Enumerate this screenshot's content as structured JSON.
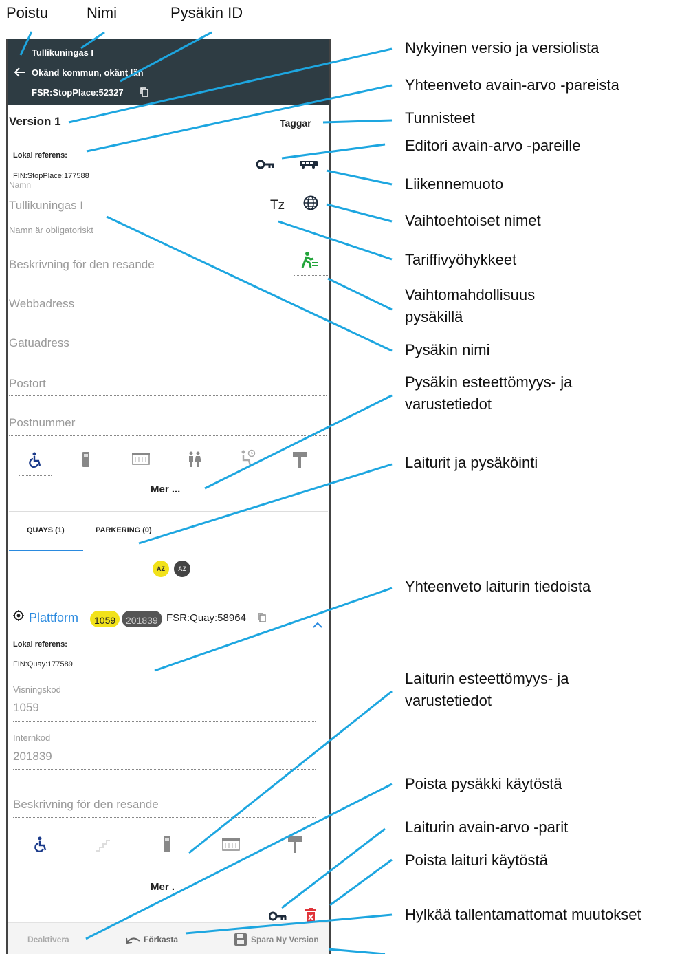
{
  "top_labels": {
    "exit": "Poistu",
    "name": "Nimi",
    "stop_id": "Pysäkin ID"
  },
  "header": {
    "stop_name": "Tullikuningas I",
    "location": "Okänd kommun, okänt län",
    "stop_id": "FSR:StopPlace:52327"
  },
  "version": {
    "label": "Version 1",
    "tags_label": "Taggar"
  },
  "local_ref": {
    "label": "Lokal referens:",
    "value": "FIN:StopPlace:177588"
  },
  "name_field": {
    "label": "Namn",
    "value": "Tullikuningas I",
    "helper": "Namn är obligatoriskt",
    "tz_label": "Tz"
  },
  "fields": {
    "description": "Beskrivning för den resande",
    "web": "Webbadress",
    "street": "Gatuadress",
    "postal_town": "Postort",
    "postal_code": "Postnummer"
  },
  "more_label": "Mer ...",
  "tabs": {
    "quays": "QUAYS (1)",
    "parking": "PARKERING (0)"
  },
  "sort": {
    "a": "AZ",
    "b": "AZ"
  },
  "quay": {
    "title": "Plattform",
    "badge1": "1059",
    "badge2": "201839",
    "quay_id": "FSR:Quay:58964",
    "local_ref_label": "Lokal referens:",
    "local_ref_value": "FIN:Quay:177589",
    "public_code_label": "Visningskod",
    "public_code_value": "1059",
    "internal_code_label": "Internkod",
    "internal_code_value": "201839",
    "description_placeholder": "Beskrivning för den resande",
    "more_label": "Mer ."
  },
  "footer": {
    "deactivate": "Deaktivera",
    "discard": "Förkasta",
    "save": "Spara Ny Version"
  },
  "callouts": {
    "c1": "Nykyinen versio ja versiolista",
    "c2": "Yhteenveto avain-arvo -pareista",
    "c3": "Tunnisteet",
    "c4": "Editori avain-arvo -pareille",
    "c5": "Liikennemuoto",
    "c6": "Vaihtoehtoiset nimet",
    "c7": "Tariffivyöhykkeet",
    "c8a": "Vaihtomahdollisuus",
    "c8b": "pysäkillä",
    "c9": "Pysäkin nimi",
    "c10a": "Pysäkin esteettömyys- ja",
    "c10b": "varustetiedot",
    "c11": "Laiturit ja pysäköinti",
    "c12": "Yhteenveto laiturin tiedoista",
    "c13a": "Laiturin esteettömyys- ja",
    "c13b": "varustetiedot",
    "c14": "Poista pysäkki käytöstä",
    "c15": "Laiturin avain-arvo -parit",
    "c16": "Poista laituri käytöstä",
    "c17": "Hylkää tallentamattomat muutokset"
  },
  "colors": {
    "header_bg": "#2e3c43",
    "callout_line": "#1da6e0",
    "badge_yellow": "#f2e21a",
    "link_blue": "#2a8adf",
    "tab_underline": "#2a8adf",
    "delete_red": "#e0343a",
    "icon_green": "#22a43a"
  }
}
